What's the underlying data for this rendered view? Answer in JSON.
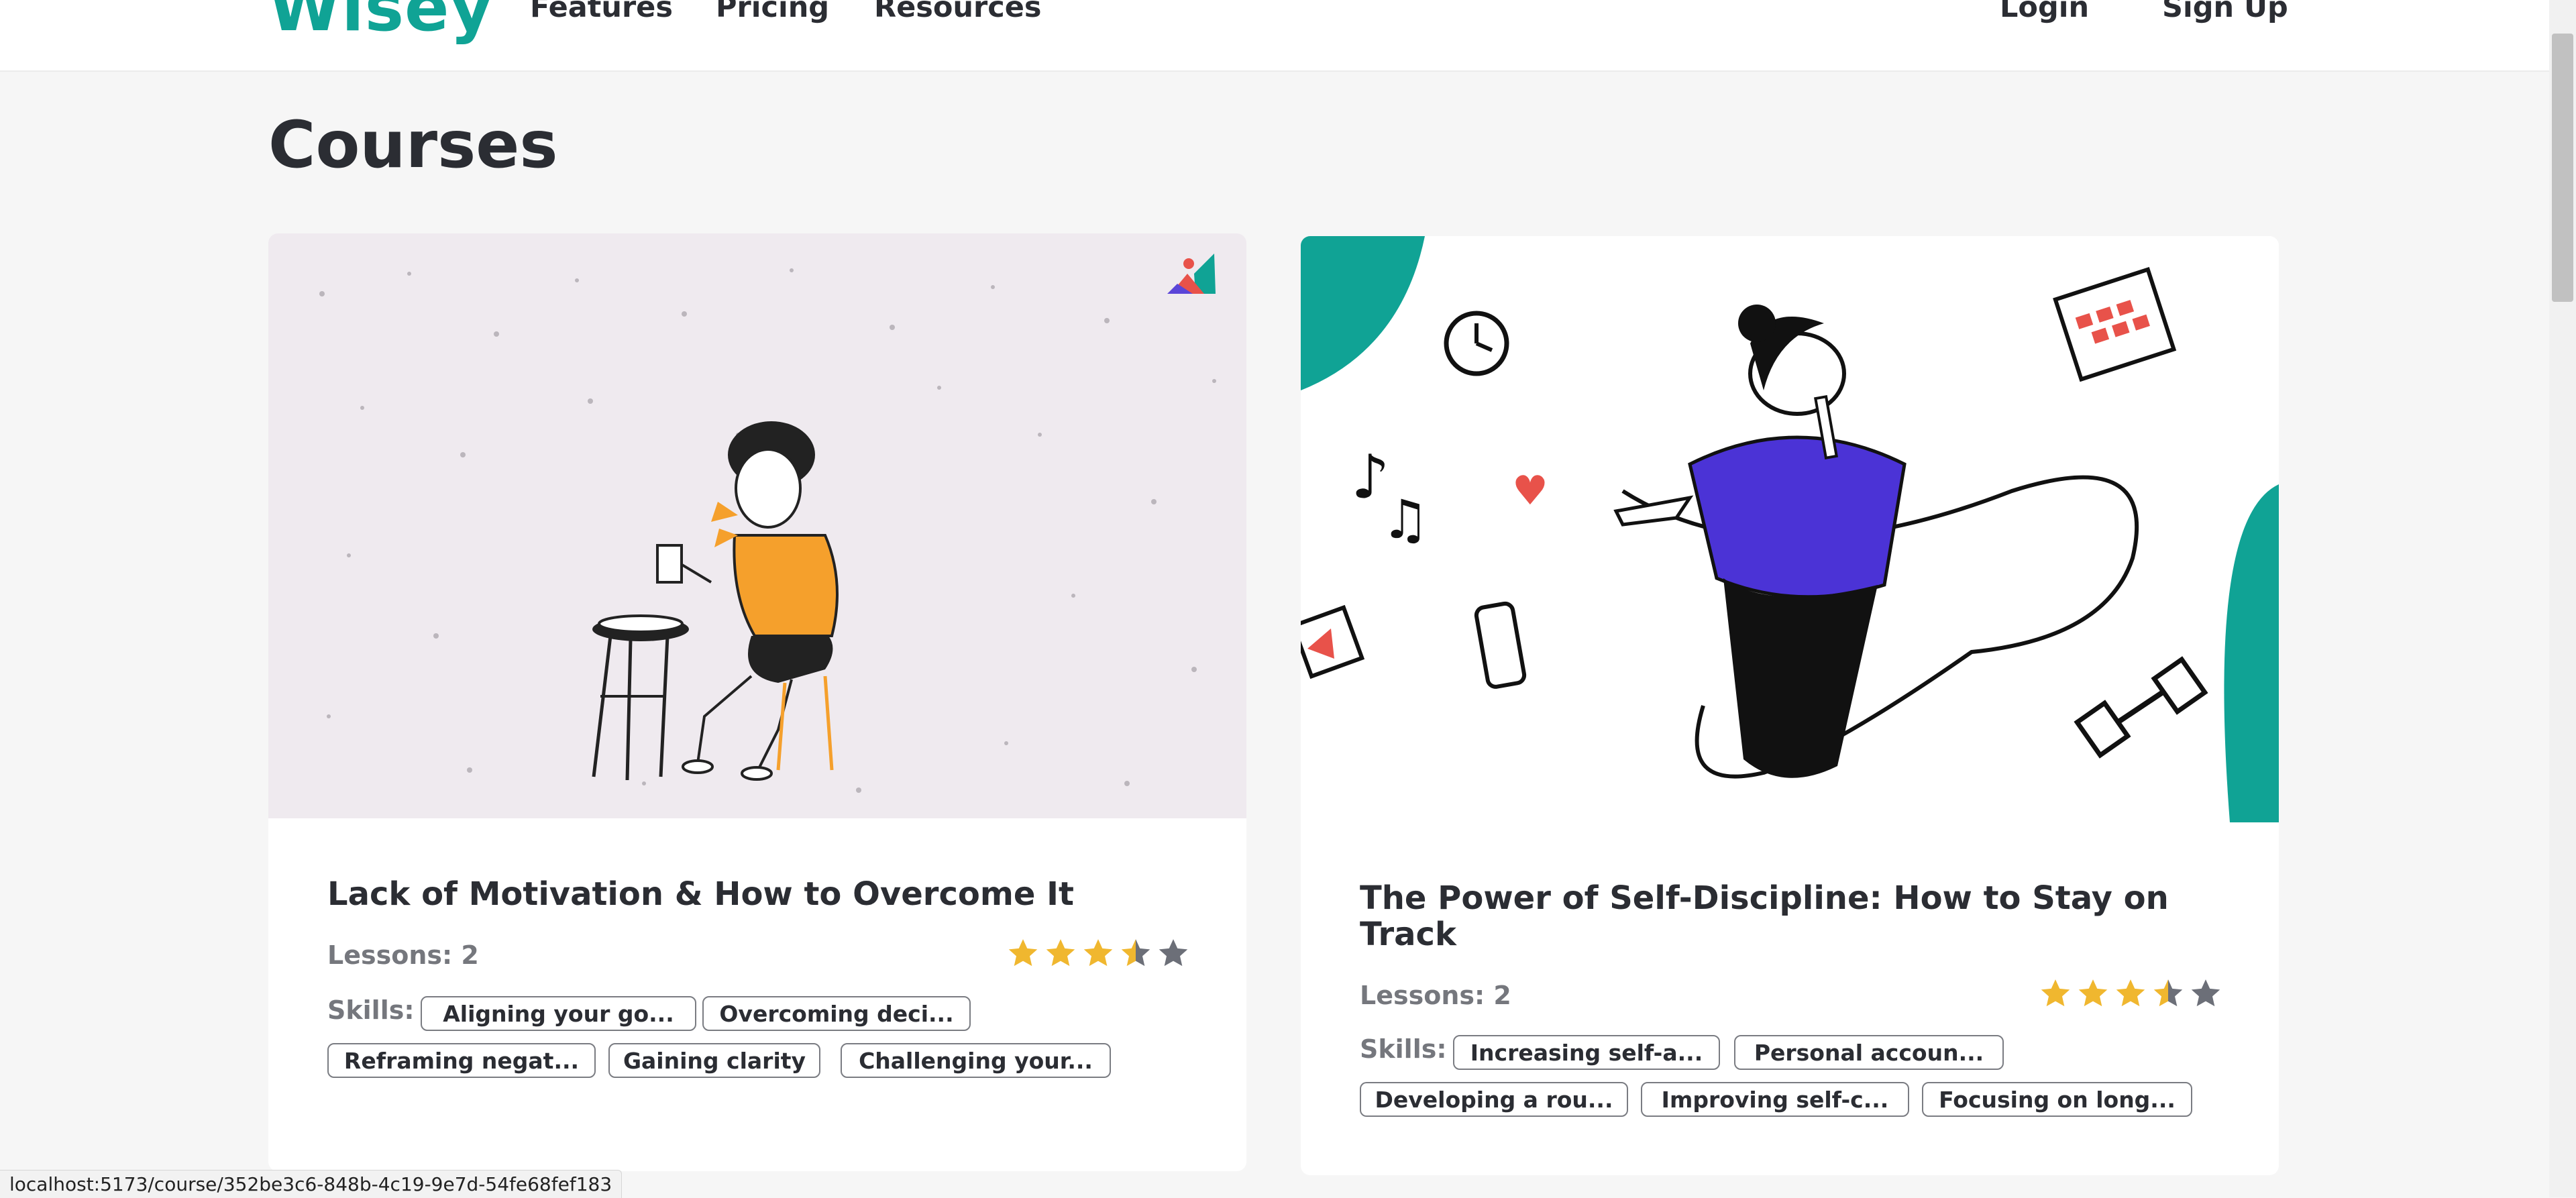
{
  "header": {
    "logo": "Wisey",
    "nav": [
      "Features",
      "Pricing",
      "Resources"
    ],
    "login": "Login",
    "signup": "Sign Up"
  },
  "page_title": "Courses",
  "cards": [
    {
      "title": "Lack of Motivation & How to Overcome It",
      "lessons": "Lessons: 2",
      "rating": 3.5,
      "skills_label": "Skills:",
      "skills": [
        "Aligning your go...",
        "Overcoming deci...",
        "Reframing negat...",
        "Gaining clarity",
        "Challenging your..."
      ]
    },
    {
      "title": "The Power of Self-Discipline: How to Stay on Track",
      "lessons": "Lessons: 2",
      "rating": 3.5,
      "skills_label": "Skills:",
      "skills": [
        "Increasing self-a...",
        "Personal accoun...",
        "Developing a rou...",
        "Improving self-c...",
        "Focusing on long..."
      ]
    }
  ],
  "status_url": "localhost:5173/course/352be3c6-848b-4c19-9e7d-54fe68fef183",
  "colors": {
    "brand": "#10a395",
    "star_filled": "#f0b72f",
    "star_empty": "#6c6f78",
    "accent_orange": "#f5a02c",
    "accent_purple": "#4b33d6"
  }
}
